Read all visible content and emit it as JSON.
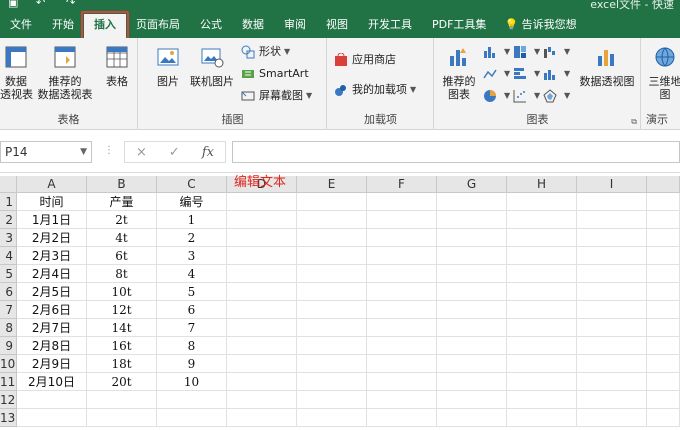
{
  "title": "excel文件 - 快速",
  "tabs": [
    "文件",
    "开始",
    "插入",
    "页面布局",
    "公式",
    "数据",
    "审阅",
    "视图",
    "开发工具",
    "PDF工具集"
  ],
  "active_tab_index": 2,
  "tell_me": "告诉我您想",
  "ribbon": {
    "group_tables": {
      "label": "表格",
      "pivot": "数据\n透视表",
      "recommended_pivot": "推荐的\n数据透视表",
      "table": "表格"
    },
    "group_illustrations": {
      "label": "插图",
      "picture": "图片",
      "online_picture": "联机图片",
      "shapes": "形状",
      "smartart": "SmartArt",
      "screenshot": "屏幕截图"
    },
    "group_addins": {
      "label": "加载项",
      "store": "应用商店",
      "my_addins": "我的加载项"
    },
    "group_charts": {
      "label": "图表",
      "recommended_charts": "推荐的\n图表",
      "pivot_chart": "数据透视图"
    },
    "group_tours": {
      "label": "演示",
      "map3d": "三维地\n图"
    }
  },
  "formula_bar": {
    "name_box": "P14",
    "cancel": "×",
    "enter": "✓",
    "fx": "fx",
    "value": ""
  },
  "sheet": {
    "columns": [
      "A",
      "B",
      "C",
      "D",
      "E",
      "F",
      "G",
      "H",
      "I"
    ],
    "rows": [
      "1",
      "2",
      "3",
      "4",
      "5",
      "6",
      "7",
      "8",
      "9",
      "10",
      "11",
      "12",
      "13"
    ],
    "data": [
      [
        "时间",
        "产量",
        "编号"
      ],
      [
        "1月1日",
        "2t",
        "1"
      ],
      [
        "2月2日",
        "4t",
        "2"
      ],
      [
        "2月3日",
        "6t",
        "3"
      ],
      [
        "2月4日",
        "8t",
        "4"
      ],
      [
        "2月5日",
        "10t",
        "5"
      ],
      [
        "2月6日",
        "12t",
        "6"
      ],
      [
        "2月7日",
        "14t",
        "7"
      ],
      [
        "2月8日",
        "16t",
        "8"
      ],
      [
        "2月9日",
        "18t",
        "9"
      ],
      [
        "2月10日",
        "20t",
        "10"
      ]
    ],
    "annotation": "编辑文本",
    "annotation_color": "#e0281e"
  },
  "colors": {
    "ribbon_green": "#217346",
    "ribbon_bg": "#f3f3f3",
    "highlight_red": "#d9403a"
  }
}
